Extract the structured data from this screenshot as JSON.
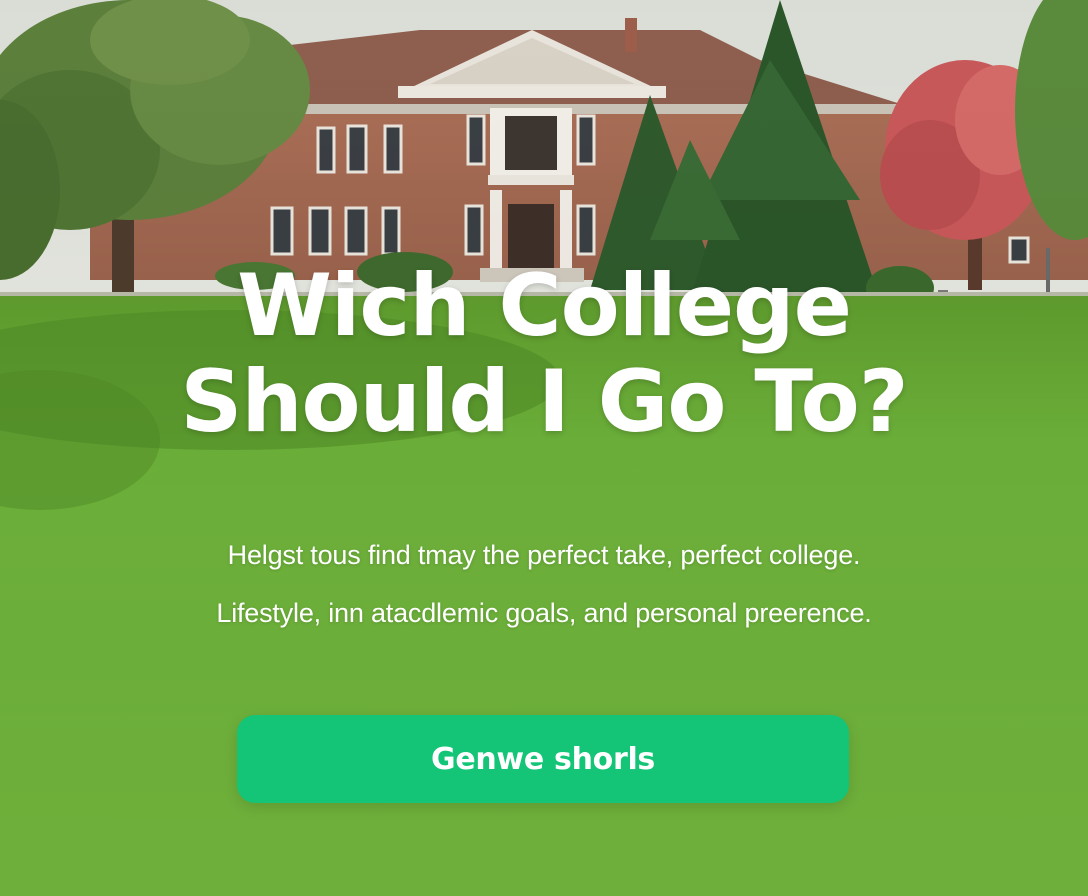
{
  "hero": {
    "title_line1": "Wich College",
    "title_line2": "Should I Go To?",
    "subtitle_line1": "Helgst tous find tmay the perfect take, perfect college.",
    "subtitle_line2": "Lifestyle, inn atacdlemic goals, and personal preerence."
  },
  "cta": {
    "label": "Genwe shorls"
  },
  "colors": {
    "button": "#14c577",
    "lawn": "#6fae3a",
    "text": "#ffffff"
  }
}
